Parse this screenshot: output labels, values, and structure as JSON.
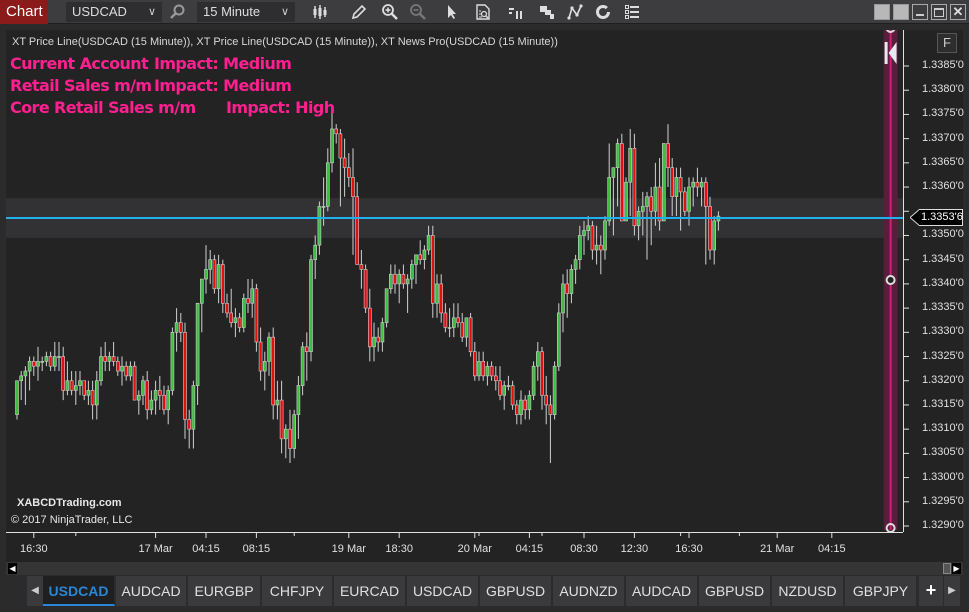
{
  "toolbar": {
    "chart_tab": "Chart",
    "instrument": "USDCAD",
    "interval": "15 Minute",
    "icons": [
      "bar-style-icon",
      "pencil-icon",
      "zoom-in-icon",
      "zoom-out-icon",
      "pointer-icon",
      "data-box-icon",
      "order-panel-icon",
      "templates-icon",
      "strategies-icon",
      "reload-icon",
      "properties-icon"
    ]
  },
  "window_controls": [
    "tile-button",
    "tile-button-2",
    "minimize-button",
    "maximize-button",
    "close-button"
  ],
  "chart": {
    "indicator_label": "XT Price Line(USDCAD (15 Minute)), XT Price Line(USDCAD (15 Minute)), XT News Pro(USDCAD (15 Minute))",
    "news": [
      {
        "event": "Current Account",
        "impact": "Impact: Medium"
      },
      {
        "event": "Retail Sales m/m",
        "impact": "Impact: Medium"
      },
      {
        "event": "Core Retail Sales m/m",
        "impact": "Impact: High"
      }
    ],
    "f_button": "F",
    "watermark": "XABCDTrading.com",
    "copyright": "© 2017 NinjaTrader, LLC",
    "current_price_label": "1.3353'6",
    "colors": {
      "up": "#3cbf3c",
      "down": "#e01010",
      "wick": "#d0d0d0",
      "price_line": "#1fb0f0",
      "news_text": "#ff1f8f",
      "news_band": "#5a1e3c",
      "news_line": "#d0207a"
    }
  },
  "chart_data": {
    "type": "candlestick",
    "title": "USDCAD 15 Minute",
    "ylim": [
      1.32885,
      1.33905
    ],
    "y_ticks": [
      "1.3385'0",
      "1.3380'0",
      "1.3375'0",
      "1.3370'0",
      "1.3365'0",
      "1.3360'0",
      "1.3355'0",
      "1.3350'0",
      "1.3345'0",
      "1.3340'0",
      "1.3335'0",
      "1.3330'0",
      "1.3325'0",
      "1.3320'0",
      "1.3315'0",
      "1.3310'0",
      "1.3305'0",
      "1.3300'0",
      "1.3295'0",
      "1.3290'0"
    ],
    "y_tick_values": [
      1.3385,
      1.338,
      1.3375,
      1.337,
      1.3365,
      1.336,
      1.3355,
      1.335,
      1.3345,
      1.334,
      1.3335,
      1.333,
      1.3325,
      1.332,
      1.3315,
      1.331,
      1.3305,
      1.33,
      1.3295,
      1.329
    ],
    "x_ticks": [
      {
        "label": "16:30",
        "bar": 4
      },
      {
        "label": "17 Mar",
        "bar": 33
      },
      {
        "label": "04:15",
        "bar": 45
      },
      {
        "label": "08:15",
        "bar": 57
      },
      {
        "label": "19 Mar",
        "bar": 79
      },
      {
        "label": "18:30",
        "bar": 91
      },
      {
        "label": "20 Mar",
        "bar": 109
      },
      {
        "label": "04:15",
        "bar": 122
      },
      {
        "label": "08:30",
        "bar": 135
      },
      {
        "label": "12:30",
        "bar": 147
      },
      {
        "label": "16:30",
        "bar": 160
      },
      {
        "label": "21 Mar",
        "bar": 181
      },
      {
        "label": "04:15",
        "bar": 194
      }
    ],
    "price_line": 1.33536,
    "price_band": [
      1.33495,
      1.33577
    ],
    "news_event_bar": 208,
    "candles_ohlc": [
      [
        1.3313,
        1.332,
        1.3312,
        1.332
      ],
      [
        1.332,
        1.3322,
        1.3316,
        1.3321
      ],
      [
        1.3321,
        1.3323,
        1.3315,
        1.3322
      ],
      [
        1.3322,
        1.3325,
        1.3318,
        1.3324
      ],
      [
        1.3324,
        1.3325,
        1.3321,
        1.3323
      ],
      [
        1.3323,
        1.3327,
        1.332,
        1.3324
      ],
      [
        1.3324,
        1.3325,
        1.3322,
        1.3324
      ],
      [
        1.3324,
        1.3326,
        1.3323,
        1.3325
      ],
      [
        1.3325,
        1.3326,
        1.3322,
        1.3323
      ],
      [
        1.3323,
        1.3328,
        1.3322,
        1.3325
      ],
      [
        1.3325,
        1.3328,
        1.3322,
        1.3325
      ],
      [
        1.3325,
        1.3327,
        1.3316,
        1.3318
      ],
      [
        1.3318,
        1.3324,
        1.3317,
        1.332
      ],
      [
        1.332,
        1.3322,
        1.3317,
        1.3318
      ],
      [
        1.3318,
        1.3322,
        1.3315,
        1.3319
      ],
      [
        1.3319,
        1.3322,
        1.3317,
        1.332
      ],
      [
        1.332,
        1.332,
        1.3316,
        1.3317
      ],
      [
        1.3317,
        1.332,
        1.3315,
        1.3318
      ],
      [
        1.3318,
        1.332,
        1.3312,
        1.3315
      ],
      [
        1.3315,
        1.3322,
        1.3312,
        1.332
      ],
      [
        1.332,
        1.3327,
        1.3319,
        1.3325
      ],
      [
        1.3325,
        1.3328,
        1.3322,
        1.3324
      ],
      [
        1.3324,
        1.3326,
        1.3322,
        1.3325
      ],
      [
        1.3325,
        1.3328,
        1.3323,
        1.3324
      ],
      [
        1.3324,
        1.3325,
        1.3321,
        1.3322
      ],
      [
        1.3322,
        1.3325,
        1.3319,
        1.3323
      ],
      [
        1.3323,
        1.3324,
        1.332,
        1.3321
      ],
      [
        1.3321,
        1.3324,
        1.332,
        1.3323
      ],
      [
        1.3323,
        1.3324,
        1.3319,
        1.3316
      ],
      [
        1.3316,
        1.3318,
        1.3313,
        1.3317
      ],
      [
        1.3317,
        1.3321,
        1.3315,
        1.332
      ],
      [
        1.332,
        1.3322,
        1.3312,
        1.3314
      ],
      [
        1.3314,
        1.3318,
        1.3313,
        1.3316
      ],
      [
        1.3316,
        1.332,
        1.3313,
        1.3318
      ],
      [
        1.3318,
        1.3321,
        1.3314,
        1.3317
      ],
      [
        1.3317,
        1.3319,
        1.3313,
        1.3314
      ],
      [
        1.3314,
        1.3319,
        1.3311,
        1.3318
      ],
      [
        1.3318,
        1.3331,
        1.3317,
        1.333
      ],
      [
        1.333,
        1.3335,
        1.3326,
        1.3332
      ],
      [
        1.3332,
        1.3334,
        1.3328,
        1.333
      ],
      [
        1.333,
        1.3332,
        1.3308,
        1.3312
      ],
      [
        1.3312,
        1.3314,
        1.3306,
        1.331
      ],
      [
        1.331,
        1.332,
        1.3306,
        1.3319
      ],
      [
        1.3319,
        1.3331,
        1.3315,
        1.3336
      ],
      [
        1.3336,
        1.334,
        1.333,
        1.3341
      ],
      [
        1.3341,
        1.3348,
        1.3338,
        1.3343
      ],
      [
        1.3343,
        1.3347,
        1.334,
        1.3345
      ],
      [
        1.3345,
        1.3346,
        1.3338,
        1.3339
      ],
      [
        1.3339,
        1.3346,
        1.3336,
        1.3344
      ],
      [
        1.3344,
        1.3345,
        1.3334,
        1.3336
      ],
      [
        1.3336,
        1.3338,
        1.3333,
        1.3334
      ],
      [
        1.3334,
        1.3339,
        1.3331,
        1.3332
      ],
      [
        1.3332,
        1.3335,
        1.3329,
        1.3333
      ],
      [
        1.3333,
        1.3334,
        1.333,
        1.3331
      ],
      [
        1.3331,
        1.3338,
        1.333,
        1.3337
      ],
      [
        1.3337,
        1.3341,
        1.3334,
        1.3336
      ],
      [
        1.3336,
        1.3341,
        1.3333,
        1.3339
      ],
      [
        1.3339,
        1.334,
        1.3326,
        1.3328
      ],
      [
        1.3328,
        1.3331,
        1.332,
        1.3322
      ],
      [
        1.3322,
        1.3326,
        1.3318,
        1.3324
      ],
      [
        1.3324,
        1.333,
        1.3321,
        1.3329
      ],
      [
        1.3329,
        1.3331,
        1.3312,
        1.3315
      ],
      [
        1.3315,
        1.332,
        1.3312,
        1.3316
      ],
      [
        1.3316,
        1.332,
        1.3305,
        1.3308
      ],
      [
        1.3308,
        1.3311,
        1.3304,
        1.331
      ],
      [
        1.331,
        1.3314,
        1.3303,
        1.3306
      ],
      [
        1.3306,
        1.3314,
        1.3304,
        1.3313
      ],
      [
        1.3313,
        1.3321,
        1.3308,
        1.3319
      ],
      [
        1.3319,
        1.3328,
        1.3317,
        1.3327
      ],
      [
        1.3327,
        1.333,
        1.332,
        1.3326
      ],
      [
        1.3326,
        1.3346,
        1.3324,
        1.3345
      ],
      [
        1.3345,
        1.335,
        1.3341,
        1.3348
      ],
      [
        1.3348,
        1.3357,
        1.3346,
        1.3356
      ],
      [
        1.3356,
        1.3362,
        1.3352,
        1.3356
      ],
      [
        1.3356,
        1.3368,
        1.3355,
        1.3365
      ],
      [
        1.3365,
        1.3376,
        1.3363,
        1.3372
      ],
      [
        1.3372,
        1.3373,
        1.3369,
        1.3371
      ],
      [
        1.3371,
        1.3372,
        1.3356,
        1.3366
      ],
      [
        1.3366,
        1.337,
        1.3358,
        1.3364
      ],
      [
        1.3364,
        1.3367,
        1.336,
        1.3362
      ],
      [
        1.3362,
        1.3368,
        1.3346,
        1.3358
      ],
      [
        1.3358,
        1.3361,
        1.3344,
        1.3344
      ],
      [
        1.3344,
        1.3347,
        1.3339,
        1.3343
      ],
      [
        1.3343,
        1.3344,
        1.3334,
        1.3335
      ],
      [
        1.3335,
        1.3339,
        1.3324,
        1.3327
      ],
      [
        1.3327,
        1.3332,
        1.3324,
        1.3329
      ],
      [
        1.3329,
        1.3331,
        1.3326,
        1.3328
      ],
      [
        1.3328,
        1.3333,
        1.3326,
        1.3332
      ],
      [
        1.3332,
        1.3337,
        1.3331,
        1.3339
      ],
      [
        1.3339,
        1.3344,
        1.3338,
        1.3342
      ],
      [
        1.3342,
        1.3344,
        1.3338,
        1.334
      ],
      [
        1.334,
        1.3343,
        1.3336,
        1.3342
      ],
      [
        1.3342,
        1.3344,
        1.3339,
        1.334
      ],
      [
        1.334,
        1.3342,
        1.3334,
        1.3341
      ],
      [
        1.3341,
        1.3345,
        1.3339,
        1.3344
      ],
      [
        1.3344,
        1.3346,
        1.334,
        1.3346
      ],
      [
        1.3346,
        1.3349,
        1.3344,
        1.3345
      ],
      [
        1.3345,
        1.3348,
        1.3343,
        1.3347
      ],
      [
        1.3347,
        1.3352,
        1.3346,
        1.335
      ],
      [
        1.335,
        1.3352,
        1.3333,
        1.3336
      ],
      [
        1.3336,
        1.3342,
        1.3333,
        1.334
      ],
      [
        1.334,
        1.3342,
        1.3332,
        1.3334
      ],
      [
        1.3334,
        1.3336,
        1.333,
        1.3331
      ],
      [
        1.3331,
        1.3335,
        1.3329,
        1.3331
      ],
      [
        1.3331,
        1.3336,
        1.3329,
        1.3333
      ],
      [
        1.3333,
        1.3336,
        1.3331,
        1.3332
      ],
      [
        1.3332,
        1.3334,
        1.3328,
        1.3329
      ],
      [
        1.3329,
        1.3333,
        1.3327,
        1.3333
      ],
      [
        1.3333,
        1.3334,
        1.3325,
        1.3326
      ],
      [
        1.3326,
        1.3328,
        1.332,
        1.3321
      ],
      [
        1.3321,
        1.3326,
        1.332,
        1.3324
      ],
      [
        1.3324,
        1.3326,
        1.332,
        1.3321
      ],
      [
        1.3321,
        1.3324,
        1.3319,
        1.3323
      ],
      [
        1.3323,
        1.3324,
        1.332,
        1.3321
      ],
      [
        1.3321,
        1.3323,
        1.3318,
        1.332
      ],
      [
        1.332,
        1.3323,
        1.3316,
        1.3317
      ],
      [
        1.3317,
        1.332,
        1.3314,
        1.3319
      ],
      [
        1.3319,
        1.3321,
        1.3318,
        1.3319
      ],
      [
        1.3319,
        1.332,
        1.3314,
        1.3315
      ],
      [
        1.3315,
        1.3316,
        1.3311,
        1.3313
      ],
      [
        1.3313,
        1.3318,
        1.3311,
        1.3316
      ],
      [
        1.3316,
        1.3317,
        1.3312,
        1.3314
      ],
      [
        1.3314,
        1.3318,
        1.3312,
        1.3317
      ],
      [
        1.3317,
        1.3324,
        1.3316,
        1.3323
      ],
      [
        1.3323,
        1.3328,
        1.332,
        1.3326
      ],
      [
        1.3326,
        1.3327,
        1.3314,
        1.3317
      ],
      [
        1.3317,
        1.3321,
        1.3311,
        1.3315
      ],
      [
        1.3315,
        1.3317,
        1.3303,
        1.3313
      ],
      [
        1.3313,
        1.3324,
        1.3312,
        1.3323
      ],
      [
        1.3323,
        1.3336,
        1.3322,
        1.3334
      ],
      [
        1.3334,
        1.3342,
        1.333,
        1.334
      ],
      [
        1.334,
        1.3343,
        1.3333,
        1.3338
      ],
      [
        1.3338,
        1.3344,
        1.3336,
        1.3343
      ],
      [
        1.3343,
        1.3346,
        1.334,
        1.3345
      ],
      [
        1.3345,
        1.3352,
        1.3343,
        1.335
      ],
      [
        1.335,
        1.3353,
        1.3346,
        1.3351
      ],
      [
        1.3351,
        1.3354,
        1.3349,
        1.3352
      ],
      [
        1.3352,
        1.3353,
        1.3345,
        1.3347
      ],
      [
        1.3347,
        1.3352,
        1.3344,
        1.3348
      ],
      [
        1.3348,
        1.335,
        1.3342,
        1.3347
      ],
      [
        1.3347,
        1.3354,
        1.3345,
        1.3353
      ],
      [
        1.3353,
        1.3369,
        1.3352,
        1.3362
      ],
      [
        1.3362,
        1.3364,
        1.335,
        1.3364
      ],
      [
        1.3364,
        1.337,
        1.3356,
        1.3369
      ],
      [
        1.3369,
        1.3371,
        1.3353,
        1.3353
      ],
      [
        1.3353,
        1.3362,
        1.3353,
        1.3361
      ],
      [
        1.3361,
        1.3372,
        1.3354,
        1.3368
      ],
      [
        1.3368,
        1.3371,
        1.335,
        1.3352
      ],
      [
        1.3352,
        1.3356,
        1.3349,
        1.3355
      ],
      [
        1.3355,
        1.3359,
        1.335,
        1.3356
      ],
      [
        1.3356,
        1.3359,
        1.3345,
        1.3358
      ],
      [
        1.3358,
        1.336,
        1.3348,
        1.3355
      ],
      [
        1.3355,
        1.3365,
        1.3352,
        1.336
      ],
      [
        1.336,
        1.3366,
        1.3351,
        1.3353
      ],
      [
        1.3353,
        1.3369,
        1.3354,
        1.3369
      ],
      [
        1.3369,
        1.3373,
        1.336,
        1.3364
      ],
      [
        1.3364,
        1.3366,
        1.3354,
        1.3358
      ],
      [
        1.3358,
        1.3364,
        1.3354,
        1.3362
      ],
      [
        1.3362,
        1.3364,
        1.3351,
        1.3359
      ],
      [
        1.3359,
        1.336,
        1.3354,
        1.3355
      ],
      [
        1.3355,
        1.3362,
        1.3352,
        1.336
      ],
      [
        1.336,
        1.3362,
        1.3356,
        1.3361
      ],
      [
        1.3361,
        1.3364,
        1.3358,
        1.336
      ],
      [
        1.336,
        1.3362,
        1.3356,
        1.3361
      ],
      [
        1.3361,
        1.3362,
        1.3344,
        1.3356
      ],
      [
        1.3356,
        1.3358,
        1.3345,
        1.3347
      ],
      [
        1.3347,
        1.3354,
        1.3344,
        1.3353
      ],
      [
        1.3353,
        1.3355,
        1.3351,
        1.3354
      ]
    ]
  },
  "tabs": {
    "items": [
      "USDCAD",
      "AUDCAD",
      "EURGBP",
      "CHFJPY",
      "EURCAD",
      "USDCAD",
      "GBPUSD",
      "AUDNZD",
      "AUDCAD",
      "GBPUSD",
      "NZDUSD",
      "GBPJPY"
    ],
    "active_index": 0,
    "add_label": "+"
  }
}
